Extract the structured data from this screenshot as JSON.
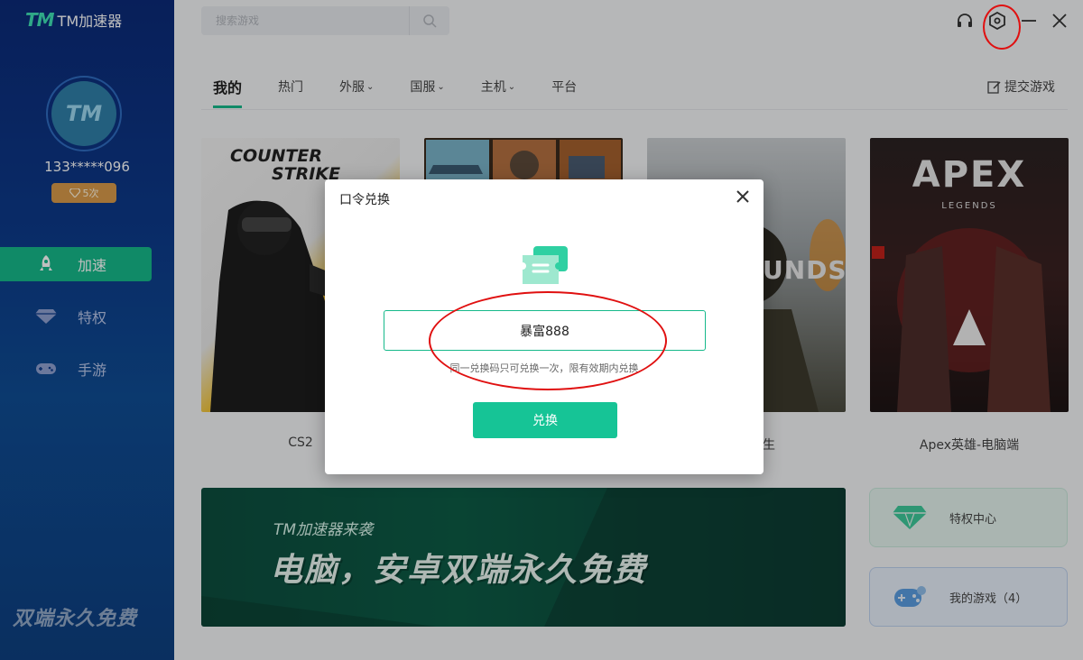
{
  "app": {
    "logo_mark": "TM",
    "name": "TM加速器"
  },
  "user": {
    "avatar_text": "TM",
    "id": "133*****096",
    "vip_count": "5次"
  },
  "sidebar": {
    "items": [
      {
        "label": "加速",
        "icon": "rocket-icon",
        "active": true
      },
      {
        "label": "特权",
        "icon": "diamond-icon",
        "active": false
      },
      {
        "label": "手游",
        "icon": "gamepad-icon",
        "active": false
      }
    ],
    "promo": "双端永久免费"
  },
  "search": {
    "placeholder": "搜索游戏"
  },
  "tabs": [
    {
      "label": "我的",
      "active": true,
      "dropdown": false
    },
    {
      "label": "热门",
      "active": false,
      "dropdown": false
    },
    {
      "label": "外服",
      "active": false,
      "dropdown": true
    },
    {
      "label": "国服",
      "active": false,
      "dropdown": true
    },
    {
      "label": "主机",
      "active": false,
      "dropdown": true
    },
    {
      "label": "平台",
      "active": false,
      "dropdown": false
    }
  ],
  "submit_game": "提交游戏",
  "games": [
    {
      "title": "CS2",
      "art_text_1": "COUNTER",
      "art_text_2": "STRIKE"
    },
    {
      "title": "",
      "art_text_1": "",
      "art_text_2": ""
    },
    {
      "title": "求生",
      "art_text_1": "UNDS",
      "art_text_2": ""
    },
    {
      "title": "Apex英雄-电脑端",
      "art_text_1": "APEX",
      "art_text_2": "LEGENDS"
    }
  ],
  "banner": {
    "subtitle": "TM加速器来袭",
    "headline": "电脑，安卓双端永久免费"
  },
  "side_cards": [
    {
      "label": "特权中心"
    },
    {
      "label": "我的游戏（4）"
    }
  ],
  "modal": {
    "title": "口令兑换",
    "code_value": "暴富888",
    "hint": "同一兑换码只可兑换一次，限有效期内兑换",
    "redeem_label": "兑换"
  },
  "colors": {
    "accent": "#16b98a",
    "sidebar": "#0d3a8a",
    "annotation": "#e01010"
  }
}
